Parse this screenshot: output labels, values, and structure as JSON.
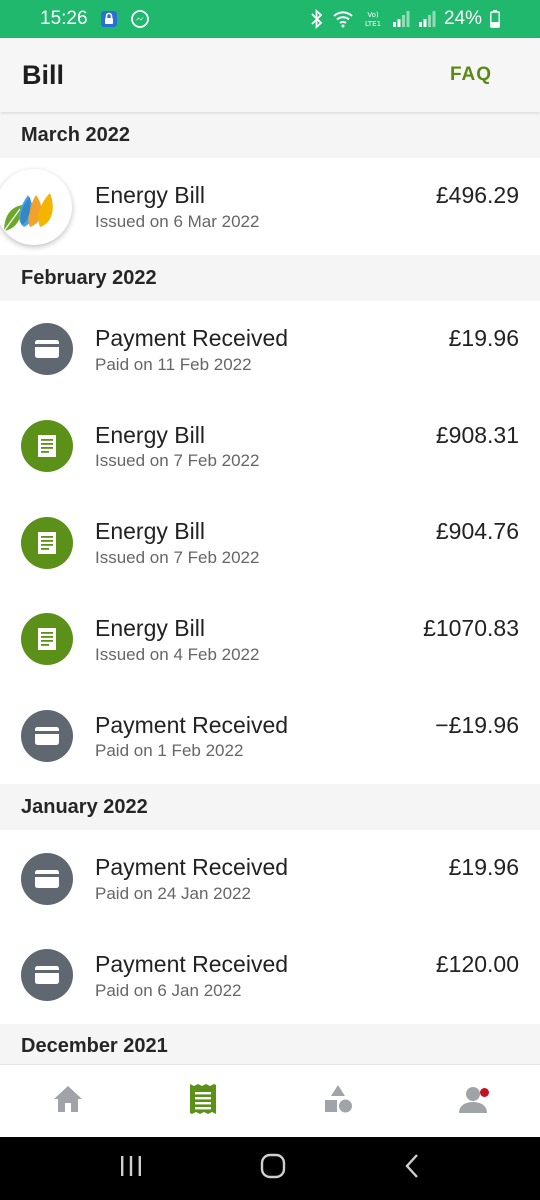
{
  "status_bar": {
    "time": "15:26",
    "battery": "24%",
    "network": "Vo) LTE1"
  },
  "app_bar": {
    "title": "Bill",
    "faq_label": "FAQ"
  },
  "sections": [
    {
      "month": "March 2022",
      "rows": [
        {
          "icon": "provider-logo-icon",
          "title": "Energy Bill",
          "subtitle": "Issued on 6 Mar 2022",
          "amount": "£496.29"
        }
      ]
    },
    {
      "month": "February 2022",
      "rows": [
        {
          "icon": "card-icon",
          "title": "Payment Received",
          "subtitle": "Paid on 11 Feb 2022",
          "amount": "£19.96"
        },
        {
          "icon": "bill-icon",
          "title": "Energy Bill",
          "subtitle": "Issued on 7 Feb 2022",
          "amount": "£908.31"
        },
        {
          "icon": "bill-icon",
          "title": "Energy Bill",
          "subtitle": "Issued on 7 Feb 2022",
          "amount": "£904.76"
        },
        {
          "icon": "bill-icon",
          "title": "Energy Bill",
          "subtitle": "Issued on 4 Feb 2022",
          "amount": "£1070.83"
        },
        {
          "icon": "card-icon",
          "title": "Payment Received",
          "subtitle": "Paid on 1 Feb 2022",
          "amount": "−£19.96"
        }
      ]
    },
    {
      "month": "January 2022",
      "rows": [
        {
          "icon": "card-icon",
          "title": "Payment Received",
          "subtitle": "Paid on 24 Jan 2022",
          "amount": "£19.96"
        },
        {
          "icon": "card-icon",
          "title": "Payment Received",
          "subtitle": "Paid on 6 Jan 2022",
          "amount": "£120.00"
        }
      ]
    },
    {
      "month": "December 2021",
      "rows": []
    }
  ],
  "bottom_nav": [
    {
      "icon": "home-icon",
      "active": false
    },
    {
      "icon": "bill-list-icon",
      "active": true
    },
    {
      "icon": "shapes-icon",
      "active": false
    },
    {
      "icon": "account-icon",
      "active": false,
      "badge": true
    }
  ],
  "system_nav": [
    "recent-apps-icon",
    "home-circle-icon",
    "back-icon"
  ],
  "colors": {
    "status_bar": "#1fb86c",
    "accent_green": "#5b9118",
    "faq_green": "#5a8a12",
    "icon_grey": "#5f6770",
    "inactive_nav": "#a0a4a8",
    "badge_red": "#c01423"
  }
}
